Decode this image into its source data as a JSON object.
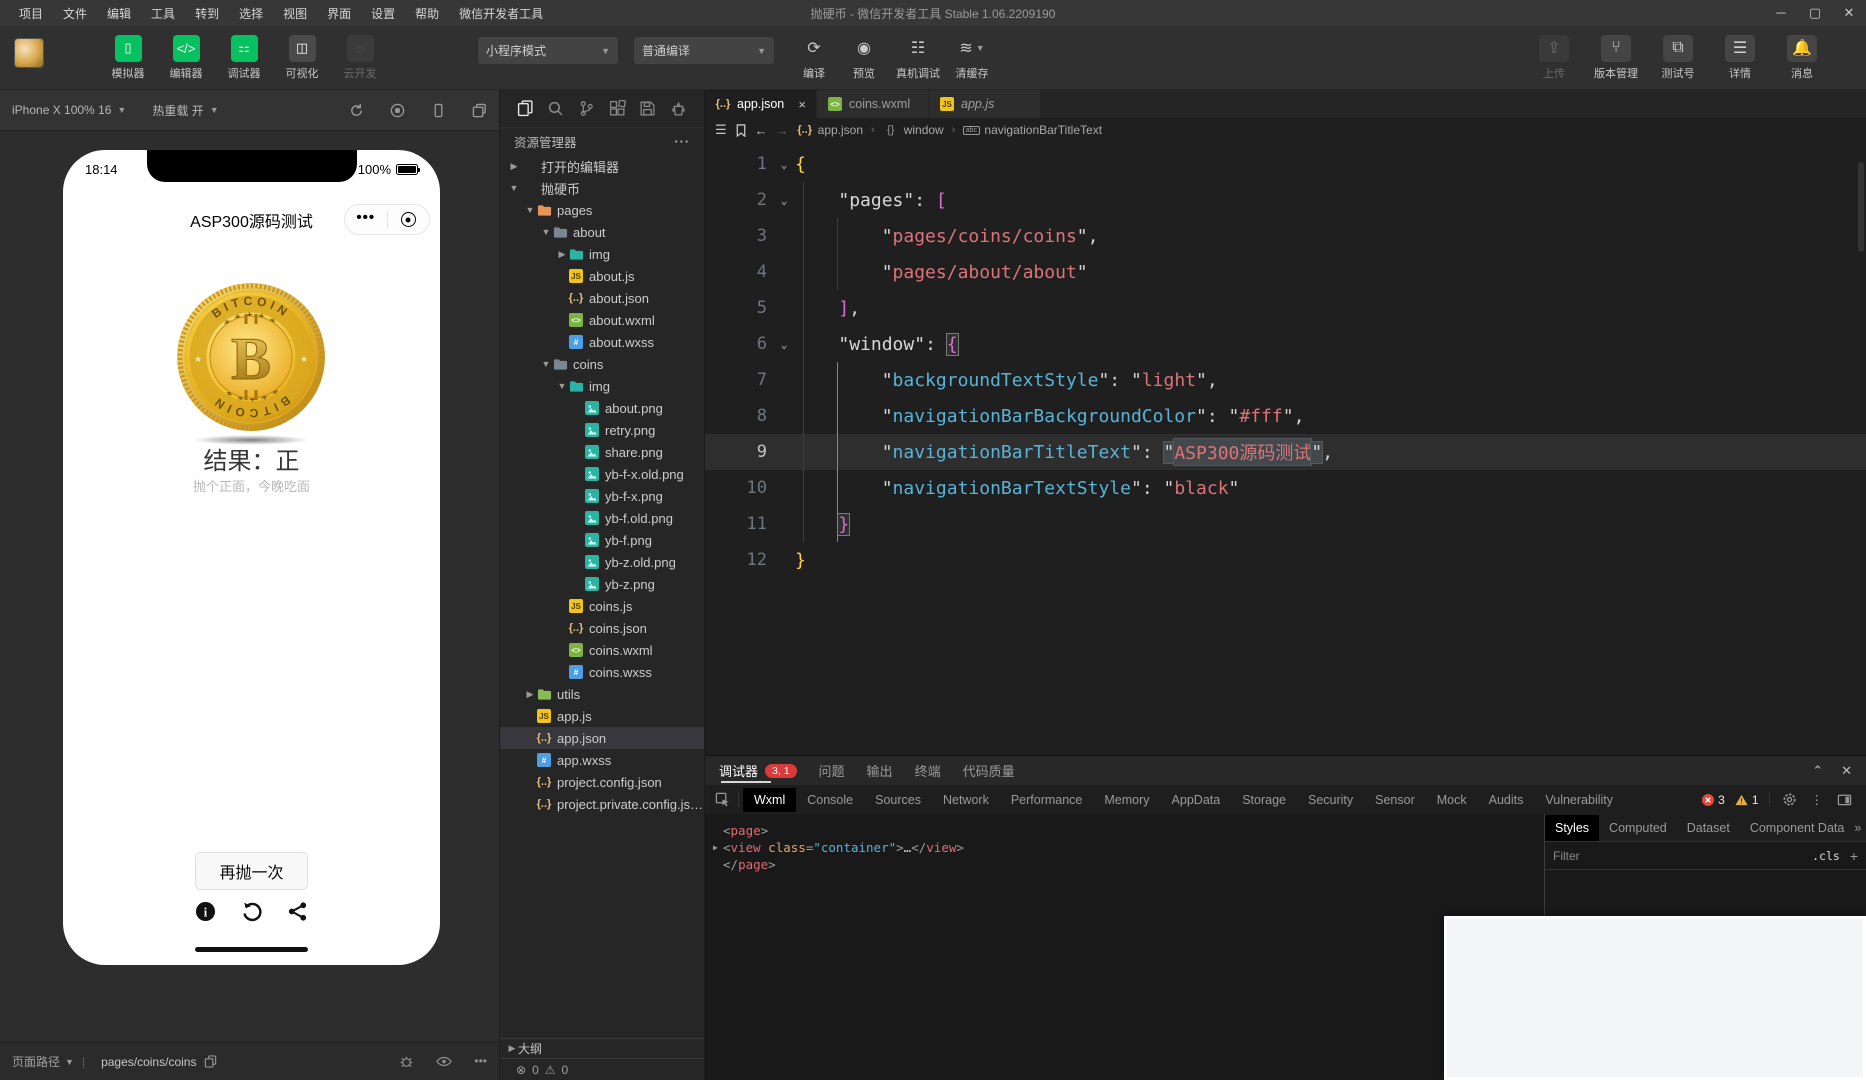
{
  "window": {
    "title": "抛硬币 - 微信开发者工具 Stable 1.06.2209190",
    "menu": [
      "项目",
      "文件",
      "编辑",
      "工具",
      "转到",
      "选择",
      "视图",
      "界面",
      "设置",
      "帮助",
      "微信开发者工具"
    ],
    "controls": [
      "─",
      "▢",
      "✕"
    ]
  },
  "toolbar": {
    "modes": [
      {
        "label": "模拟器",
        "icon": "simulator-icon",
        "state": "green"
      },
      {
        "label": "编辑器",
        "icon": "editor-icon",
        "state": "green"
      },
      {
        "label": "调试器",
        "icon": "debugger-icon",
        "state": "green"
      },
      {
        "label": "可视化",
        "icon": "visual-icon",
        "state": "gray"
      },
      {
        "label": "云开发",
        "icon": "cloud-icon",
        "state": "disabled"
      }
    ],
    "mode_select": "小程序模式",
    "compile_select": "普通编译",
    "actions": [
      {
        "label": "编译",
        "icon": "compile-icon"
      },
      {
        "label": "预览",
        "icon": "preview-icon"
      },
      {
        "label": "真机调试",
        "icon": "remote-debug-icon"
      },
      {
        "label": "清缓存",
        "icon": "clear-cache-icon",
        "caret": true
      }
    ],
    "right_actions": [
      {
        "label": "上传",
        "icon": "upload-icon",
        "disabled": true
      },
      {
        "label": "版本管理",
        "icon": "version-icon"
      },
      {
        "label": "测试号",
        "icon": "testid-icon"
      },
      {
        "label": "详情",
        "icon": "details-icon"
      },
      {
        "label": "消息",
        "icon": "message-icon"
      }
    ]
  },
  "simulator": {
    "device": "iPhone X 100% 16",
    "hot_reload": "热重载 开",
    "phone": {
      "time": "18:14",
      "battery": "100%",
      "nav_title": "ASP300源码测试",
      "coin_word_top": "BITCOIN",
      "coin_word_bottom": "BITCOIN",
      "result": "结果：正",
      "hint": "抛个正面，今晚吃面",
      "retry": "再抛一次"
    },
    "status": {
      "label": "页面路径",
      "path": "pages/coins/coins"
    }
  },
  "explorer": {
    "header": "资源管理器",
    "items": [
      {
        "label": "打开的编辑器",
        "chev": "right",
        "depth": 0
      },
      {
        "label": "抛硬币",
        "chev": "down",
        "depth": 0
      },
      {
        "label": "pages",
        "icon": "folder-pages",
        "chev": "down",
        "depth": 1
      },
      {
        "label": "about",
        "icon": "folder",
        "chev": "down",
        "depth": 2
      },
      {
        "label": "img",
        "icon": "folder-img",
        "chev": "right",
        "depth": 3
      },
      {
        "label": "about.js",
        "icon": "js",
        "depth": 3
      },
      {
        "label": "about.json",
        "icon": "json",
        "depth": 3
      },
      {
        "label": "about.wxml",
        "icon": "wxml",
        "depth": 3
      },
      {
        "label": "about.wxss",
        "icon": "wxss",
        "depth": 3
      },
      {
        "label": "coins",
        "icon": "folder",
        "chev": "down",
        "depth": 2
      },
      {
        "label": "img",
        "icon": "folder-img",
        "chev": "down",
        "depth": 3
      },
      {
        "label": "about.png",
        "icon": "img",
        "depth": 4
      },
      {
        "label": "retry.png",
        "icon": "img",
        "depth": 4
      },
      {
        "label": "share.png",
        "icon": "img",
        "depth": 4
      },
      {
        "label": "yb-f-x.old.png",
        "icon": "img",
        "depth": 4
      },
      {
        "label": "yb-f-x.png",
        "icon": "img",
        "depth": 4
      },
      {
        "label": "yb-f.old.png",
        "icon": "img",
        "depth": 4
      },
      {
        "label": "yb-f.png",
        "icon": "img",
        "depth": 4
      },
      {
        "label": "yb-z.old.png",
        "icon": "img",
        "depth": 4
      },
      {
        "label": "yb-z.png",
        "icon": "img",
        "depth": 4
      },
      {
        "label": "coins.js",
        "icon": "js",
        "depth": 3
      },
      {
        "label": "coins.json",
        "icon": "json",
        "depth": 3
      },
      {
        "label": "coins.wxml",
        "icon": "wxml",
        "depth": 3
      },
      {
        "label": "coins.wxss",
        "icon": "wxss",
        "depth": 3
      },
      {
        "label": "utils",
        "icon": "folder-utils",
        "chev": "right",
        "depth": 1
      },
      {
        "label": "app.js",
        "icon": "js",
        "depth": 1
      },
      {
        "label": "app.json",
        "icon": "json",
        "depth": 1,
        "selected": true
      },
      {
        "label": "app.wxss",
        "icon": "wxss",
        "depth": 1
      },
      {
        "label": "project.config.json",
        "icon": "json",
        "depth": 1
      },
      {
        "label": "project.private.config.js…",
        "icon": "json",
        "depth": 1
      }
    ],
    "outline": "大纲",
    "problems": {
      "errors": "0",
      "warnings": "0"
    }
  },
  "editor": {
    "tabs": [
      {
        "name": "app.json",
        "icon": "json",
        "active": true,
        "closable": true
      },
      {
        "name": "coins.wxml",
        "icon": "wxml"
      },
      {
        "name": "app.js",
        "icon": "js",
        "preview": true
      }
    ],
    "breadcrumb": [
      {
        "icon": "json",
        "label": "app.json"
      },
      {
        "icon": "braces",
        "label": "window"
      },
      {
        "icon": "abc",
        "label": "navigationBarTitleText"
      }
    ],
    "code_lines": [
      {
        "num": "1",
        "fold": true,
        "guides": [],
        "tokens": [
          {
            "t": "{",
            "c": "b1"
          }
        ]
      },
      {
        "num": "2",
        "fold": true,
        "guides": [
          "a"
        ],
        "tokens": [
          {
            "t": "    ",
            "c": "p"
          },
          {
            "t": "\"pages\"",
            "c": "k1"
          },
          {
            "t": ": ",
            "c": "p"
          },
          {
            "t": "[",
            "c": "b2"
          }
        ]
      },
      {
        "num": "3",
        "guides": [
          "a",
          "b"
        ],
        "tokens": [
          {
            "t": "        ",
            "c": "p"
          },
          {
            "t": "\"",
            "c": "p"
          },
          {
            "t": "pages/coins/coins",
            "c": "s"
          },
          {
            "t": "\"",
            "c": "p"
          },
          {
            "t": ",",
            "c": "p"
          }
        ]
      },
      {
        "num": "4",
        "guides": [
          "a",
          "b"
        ],
        "tokens": [
          {
            "t": "        ",
            "c": "p"
          },
          {
            "t": "\"",
            "c": "p"
          },
          {
            "t": "pages/about/about",
            "c": "s"
          },
          {
            "t": "\"",
            "c": "p"
          }
        ]
      },
      {
        "num": "5",
        "guides": [
          "a"
        ],
        "tokens": [
          {
            "t": "    ",
            "c": "p"
          },
          {
            "t": "]",
            "c": "b2"
          },
          {
            "t": ",",
            "c": "p"
          }
        ]
      },
      {
        "num": "6",
        "fold": true,
        "guides": [
          "a"
        ],
        "tokens": [
          {
            "t": "    ",
            "c": "p"
          },
          {
            "t": "\"window\"",
            "c": "k1"
          },
          {
            "t": ": ",
            "c": "p"
          },
          {
            "t": "{",
            "c": "b2",
            "x": "box"
          }
        ]
      },
      {
        "num": "7",
        "guides": [
          "a",
          "B"
        ],
        "tokens": [
          {
            "t": "        ",
            "c": "p"
          },
          {
            "t": "\"",
            "c": "p"
          },
          {
            "t": "backgroundTextStyle",
            "c": "k2"
          },
          {
            "t": "\"",
            "c": "p"
          },
          {
            "t": ": ",
            "c": "p"
          },
          {
            "t": "\"",
            "c": "p"
          },
          {
            "t": "light",
            "c": "s"
          },
          {
            "t": "\"",
            "c": "p"
          },
          {
            "t": ",",
            "c": "p"
          }
        ]
      },
      {
        "num": "8",
        "guides": [
          "a",
          "B"
        ],
        "tokens": [
          {
            "t": "        ",
            "c": "p"
          },
          {
            "t": "\"",
            "c": "p"
          },
          {
            "t": "navigationBarBackgroundColor",
            "c": "k2"
          },
          {
            "t": "\"",
            "c": "p"
          },
          {
            "t": ": ",
            "c": "p"
          },
          {
            "t": "\"",
            "c": "p"
          },
          {
            "t": "#fff",
            "c": "s"
          },
          {
            "t": "\"",
            "c": "p"
          },
          {
            "t": ",",
            "c": "p"
          }
        ]
      },
      {
        "num": "9",
        "active": true,
        "guides": [
          "a",
          "B"
        ],
        "tokens": [
          {
            "t": "        ",
            "c": "p"
          },
          {
            "t": "\"",
            "c": "p"
          },
          {
            "t": "navigationBarTitleText",
            "c": "k2"
          },
          {
            "t": "\"",
            "c": "p"
          },
          {
            "t": ": ",
            "c": "p"
          },
          {
            "t": "\"",
            "c": "p",
            "x": "hl"
          },
          {
            "t": "ASP300源码测试",
            "c": "s",
            "x": "hl"
          },
          {
            "t": "\"",
            "c": "p",
            "x": "hl"
          },
          {
            "t": ",",
            "c": "p"
          }
        ]
      },
      {
        "num": "10",
        "guides": [
          "a",
          "B"
        ],
        "tokens": [
          {
            "t": "        ",
            "c": "p"
          },
          {
            "t": "\"",
            "c": "p"
          },
          {
            "t": "navigationBarTextStyle",
            "c": "k2"
          },
          {
            "t": "\"",
            "c": "p"
          },
          {
            "t": ": ",
            "c": "p"
          },
          {
            "t": "\"",
            "c": "p"
          },
          {
            "t": "black",
            "c": "s"
          },
          {
            "t": "\"",
            "c": "p"
          }
        ]
      },
      {
        "num": "11",
        "guides": [
          "a",
          "B"
        ],
        "tokens": [
          {
            "t": "    ",
            "c": "p"
          },
          {
            "t": "}",
            "c": "b2",
            "x": "box"
          }
        ]
      },
      {
        "num": "12",
        "guides": [],
        "tokens": [
          {
            "t": "}",
            "c": "b1"
          }
        ]
      }
    ]
  },
  "debugger": {
    "panel_tabs": [
      {
        "label": "调试器",
        "active": true,
        "badge": "3, 1"
      },
      {
        "label": "问题"
      },
      {
        "label": "输出"
      },
      {
        "label": "终端"
      },
      {
        "label": "代码质量"
      }
    ],
    "tool_tabs": [
      "Wxml",
      "Console",
      "Sources",
      "Network",
      "Performance",
      "Memory",
      "AppData",
      "Storage",
      "Security",
      "Sensor",
      "Mock",
      "Audits",
      "Vulnerability"
    ],
    "active_tool_tab": "Wxml",
    "badges": {
      "errors": "3",
      "warnings": "1"
    },
    "wxml_lines": [
      {
        "arrow": "none",
        "tokens": [
          {
            "t": "<",
            "c": "pu"
          },
          {
            "t": "page",
            "c": "tag"
          },
          {
            "t": ">",
            "c": "pu"
          }
        ]
      },
      {
        "arrow": "right",
        "tokens": [
          {
            "t": "<",
            "c": "pu"
          },
          {
            "t": "view",
            "c": "tag"
          },
          {
            "t": " ",
            "c": "pu"
          },
          {
            "t": "class",
            "c": "attr"
          },
          {
            "t": "=",
            "c": "pu"
          },
          {
            "t": "\"container\"",
            "c": "val"
          },
          {
            "t": ">",
            "c": "pu"
          },
          {
            "t": "…",
            "c": "txt"
          },
          {
            "t": "</",
            "c": "pu"
          },
          {
            "t": "view",
            "c": "tag"
          },
          {
            "t": ">",
            "c": "pu"
          }
        ]
      },
      {
        "arrow": "none",
        "tokens": [
          {
            "t": "</",
            "c": "pu"
          },
          {
            "t": "page",
            "c": "tag"
          },
          {
            "t": ">",
            "c": "pu"
          }
        ]
      }
    ],
    "styles_tabs": [
      "Styles",
      "Computed",
      "Dataset",
      "Component Data"
    ],
    "active_styles_tab": "Styles",
    "filter_placeholder": "Filter",
    "cls_label": ".cls"
  },
  "colors": {
    "accent_green": "#07c160",
    "badge_red": "#d93b3b",
    "warn_yellow": "#e2b341",
    "nav_bar_bg": "#fff"
  }
}
